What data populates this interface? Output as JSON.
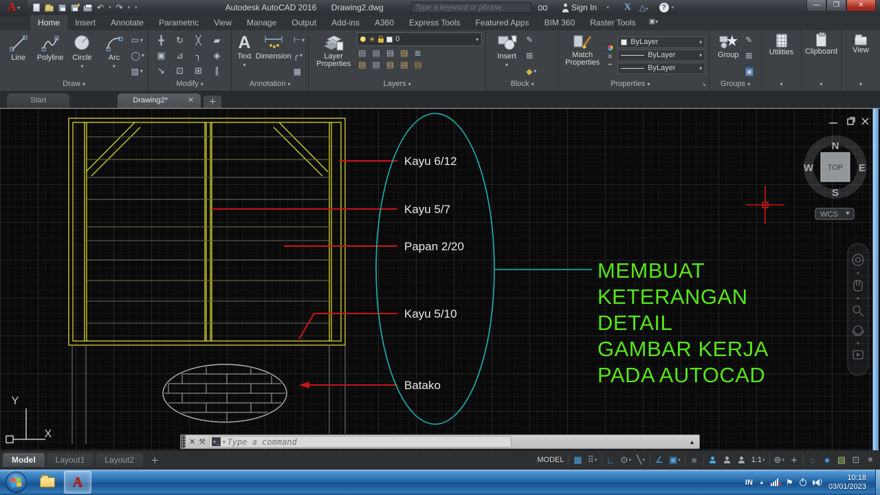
{
  "title_bar": {
    "app_title": "Autodesk AutoCAD 2016",
    "doc_title": "Drawing2.dwg",
    "search_placeholder": "Type a keyword or phrase",
    "sign_in_label": "Sign In"
  },
  "ribbon": {
    "tabs": [
      "Home",
      "Insert",
      "Annotate",
      "Parametric",
      "View",
      "Manage",
      "Output",
      "Add-ins",
      "A360",
      "Express Tools",
      "Featured Apps",
      "BIM 360",
      "Raster Tools"
    ],
    "draw": {
      "label": "Draw",
      "line": "Line",
      "polyline": "Polyline",
      "circle": "Circle",
      "arc": "Arc"
    },
    "modify": {
      "label": "Modify"
    },
    "annotation": {
      "label": "Annotation",
      "text": "Text",
      "dimension": "Dimension"
    },
    "layers": {
      "label": "Layers",
      "layer_properties": "Layer Properties",
      "current_layer": "0"
    },
    "block": {
      "label": "Block",
      "insert": "Insert"
    },
    "properties": {
      "label": "Properties",
      "match_properties": "Match Properties",
      "color": "ByLayer",
      "lineweight": "ByLayer",
      "linetype": "ByLayer"
    },
    "groups": {
      "label": "Groups",
      "group": "Group"
    },
    "utilities": {
      "label": "Utilities"
    },
    "clipboard": {
      "label": "Clipboard"
    },
    "view": {
      "label": "View"
    }
  },
  "file_tabs": {
    "start": "Start",
    "drawing": "Drawing2*"
  },
  "drawing_area": {
    "callouts": [
      "Kayu 6/12",
      "Kayu 5/7",
      "Papan 2/20",
      "Kayu 5/10",
      "Batako"
    ],
    "title_lines": [
      "MEMBUAT",
      "KETERANGAN",
      "DETAIL",
      "GAMBAR KERJA",
      "PADA AUTOCAD"
    ],
    "viewcube": {
      "north": "N",
      "east": "E",
      "south": "S",
      "west": "W",
      "top": "TOP",
      "wcs": "WCS"
    },
    "ucs": {
      "x_label": "X",
      "y_label": "Y"
    }
  },
  "command_line": {
    "placeholder": "Type a command"
  },
  "status_bar": {
    "model_tab": "Model",
    "layout1_tab": "Layout1",
    "layout2_tab": "Layout2",
    "model_badge": "MODEL",
    "annotation_scale": "1:1"
  },
  "taskbar": {
    "language": "IN",
    "time": "10:18",
    "date": "03/01/2023"
  },
  "colors": {
    "frame_yellow": "#d6d62e",
    "leader_red": "#cc1414",
    "ellipse_cyan": "#1ab6ae",
    "note_green": "#57e41a"
  }
}
